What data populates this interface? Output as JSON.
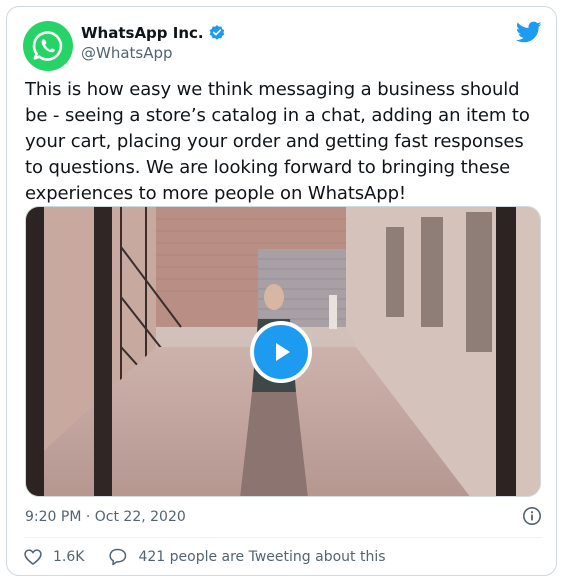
{
  "author": {
    "display_name": "WhatsApp Inc.",
    "handle": "@WhatsApp",
    "verified": true
  },
  "tweet": {
    "text": "This is how easy we think messaging a business should be - seeing a store’s catalog in a chat, adding an item to your cart, placing your order and getting fast responses to questions. We are looking forward to bringing these experiences to more people on WhatsApp!",
    "timestamp": "9:20 PM · Oct 22, 2020"
  },
  "stats": {
    "likes": "1.6K",
    "tweeting": "421 people are Tweeting about this"
  },
  "icons": {
    "avatar": "whatsapp-logo-icon",
    "verified": "verified-badge-icon",
    "brand": "twitter-bird-icon",
    "play": "play-icon",
    "info": "info-icon",
    "like": "heart-icon",
    "reply": "speech-bubble-icon"
  },
  "colors": {
    "whatsapp_green": "#25d366",
    "twitter_blue": "#1d9bf0",
    "text": "#0f1419",
    "secondary_text": "#536471",
    "border": "#cfd9de"
  }
}
